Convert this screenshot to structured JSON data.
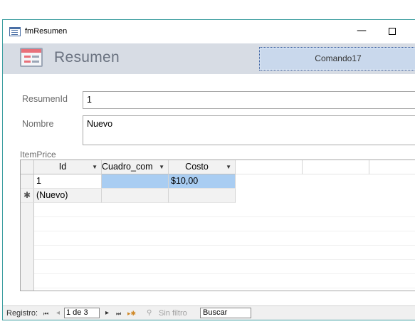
{
  "window": {
    "title": "fmResumen",
    "minimize_glyph": "—",
    "icon": "form-icon"
  },
  "header": {
    "heading": "Resumen",
    "command_button_label": "Comando17",
    "logo_icon": "form-logo-icon"
  },
  "fields": {
    "resumen_id": {
      "label": "ResumenId",
      "value": "1"
    },
    "nombre": {
      "label": "Nombre",
      "value": "Nuevo"
    }
  },
  "subform": {
    "label": "ItemPrice",
    "columns": [
      {
        "label": "Id",
        "dropdown": "▼"
      },
      {
        "label": "Cuadro_com",
        "dropdown": "▼"
      },
      {
        "label": "Costo",
        "dropdown": "▼"
      }
    ],
    "rows": [
      {
        "selector": "",
        "id": "1",
        "cuadro": "",
        "costo": "$10,00"
      },
      {
        "selector": "✱",
        "id": "(Nuevo)",
        "cuadro": "",
        "costo": ""
      }
    ]
  },
  "navbar": {
    "label": "Registro:",
    "first": "⏮",
    "prev": "◂",
    "record_text": "1 de 3",
    "next": "▸",
    "last": "⏭",
    "new": "▸✱",
    "filter_icon": "filter-icon",
    "filter_label": "Sin filtro",
    "search_label": "Buscar"
  },
  "colors": {
    "header_bg": "#d7dce4",
    "selection_blue": "#a9cdf2",
    "window_border": "#3c9ea0"
  }
}
